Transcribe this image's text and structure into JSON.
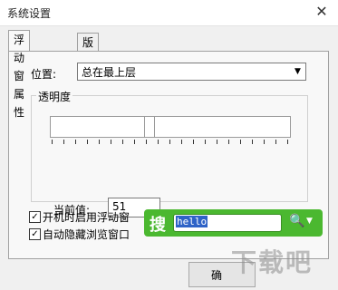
{
  "window": {
    "title": "系统设置",
    "close_symbol": "✕"
  },
  "tabs": [
    {
      "label": "浮动窗属性",
      "active": true
    },
    {
      "label": "版本升级",
      "active": false
    }
  ],
  "position": {
    "label": "位置:",
    "value": "总在最上层"
  },
  "transparency": {
    "group_title": "透明度",
    "slider_value": 51,
    "current_label": "当前值:",
    "current_value": "51"
  },
  "options": [
    {
      "label": "开机时启用浮动窗",
      "checked": true
    },
    {
      "label": "自动隐藏浏览窗口",
      "checked": true
    }
  ],
  "search_widget": {
    "icon_glyph": "搜",
    "text": "hello",
    "color": "#4bb830"
  },
  "ok_button": {
    "label": "确"
  },
  "watermark": {
    "text": "下载吧"
  }
}
